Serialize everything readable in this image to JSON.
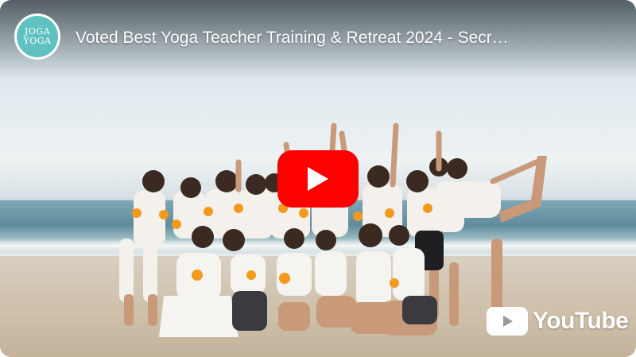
{
  "video": {
    "title": "Voted Best Yoga Teacher Training & Retreat 2024 - Secr…",
    "channel_logo_text": [
      "JOGA",
      "YOGA"
    ],
    "play_button_icon": "play-icon",
    "brand_label": "YouTube",
    "brand_icon": "youtube-play-icon"
  },
  "colors": {
    "play_red": "#ff0000",
    "logo_teal": "#5fc2c0",
    "overlay_text": "#ffffff"
  }
}
